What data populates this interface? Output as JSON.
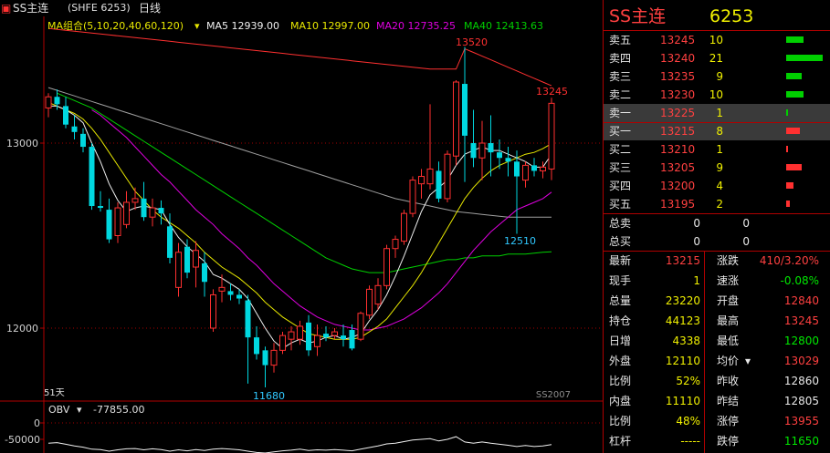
{
  "toolbar": {
    "symbol": "SS主连",
    "exchange": "(SHFE 6253)",
    "period": "日线"
  },
  "indicators": {
    "group_label": "MA组合(5,10,20,40,60,120)",
    "ma5": "MA5 12939.00",
    "ma10": "MA10 12997.00",
    "ma20": "MA20 12735.25",
    "ma40": "MA40 12413.63",
    "colors": {
      "ma5": "#f0f0f0",
      "ma10": "#e8e800",
      "ma20": "#e000e0",
      "ma40": "#00d000",
      "ma60": "#a0a0a0",
      "ma120": "#ff3030"
    }
  },
  "chart": {
    "price_ticks": [
      "13000",
      "12000"
    ],
    "annotations": {
      "high": "13520",
      "last_close": "13245",
      "local_low": "12510",
      "low": "11680"
    },
    "days_label": "51天",
    "watermark": "SS2007",
    "obv_label": "OBV",
    "obv_value": "-77855.00",
    "obv_ticks": [
      "0",
      "-50000"
    ],
    "candles": [
      {
        "o": 13190,
        "h": 13270,
        "l": 13140,
        "c": 13250
      },
      {
        "o": 13250,
        "h": 13290,
        "l": 13180,
        "c": 13210
      },
      {
        "o": 13200,
        "h": 13250,
        "l": 13080,
        "c": 13100
      },
      {
        "o": 13090,
        "h": 13150,
        "l": 13020,
        "c": 13060
      },
      {
        "o": 13050,
        "h": 13080,
        "l": 12950,
        "c": 12980
      },
      {
        "o": 12980,
        "h": 13000,
        "l": 12640,
        "c": 12660
      },
      {
        "o": 12660,
        "h": 12740,
        "l": 12630,
        "c": 12650
      },
      {
        "o": 12640,
        "h": 12700,
        "l": 12460,
        "c": 12480
      },
      {
        "o": 12500,
        "h": 12680,
        "l": 12460,
        "c": 12650
      },
      {
        "o": 12560,
        "h": 12740,
        "l": 12540,
        "c": 12680
      },
      {
        "o": 12680,
        "h": 12760,
        "l": 12640,
        "c": 12700
      },
      {
        "o": 12700,
        "h": 12790,
        "l": 12580,
        "c": 12600
      },
      {
        "o": 12600,
        "h": 12700,
        "l": 12550,
        "c": 12650
      },
      {
        "o": 12650,
        "h": 12690,
        "l": 12560,
        "c": 12620
      },
      {
        "o": 12550,
        "h": 12620,
        "l": 12350,
        "c": 12380
      },
      {
        "o": 12220,
        "h": 12460,
        "l": 12170,
        "c": 12410
      },
      {
        "o": 12440,
        "h": 12480,
        "l": 12270,
        "c": 12300
      },
      {
        "o": 12330,
        "h": 12470,
        "l": 12220,
        "c": 12420
      },
      {
        "o": 12350,
        "h": 12410,
        "l": 12170,
        "c": 12250
      },
      {
        "o": 12000,
        "h": 12210,
        "l": 11980,
        "c": 12180
      },
      {
        "o": 12200,
        "h": 12290,
        "l": 12140,
        "c": 12220
      },
      {
        "o": 12200,
        "h": 12240,
        "l": 12150,
        "c": 12180
      },
      {
        "o": 12180,
        "h": 12210,
        "l": 12130,
        "c": 12160
      },
      {
        "o": 12150,
        "h": 12180,
        "l": 11700,
        "c": 11950
      },
      {
        "o": 11950,
        "h": 12010,
        "l": 11830,
        "c": 11860
      },
      {
        "o": 11880,
        "h": 11900,
        "l": 11680,
        "c": 11800
      },
      {
        "o": 11800,
        "h": 11920,
        "l": 11760,
        "c": 11880
      },
      {
        "o": 11880,
        "h": 11980,
        "l": 11860,
        "c": 11960
      },
      {
        "o": 11940,
        "h": 12010,
        "l": 11880,
        "c": 11980
      },
      {
        "o": 11940,
        "h": 12040,
        "l": 11910,
        "c": 12010
      },
      {
        "o": 12030,
        "h": 12070,
        "l": 11850,
        "c": 11880
      },
      {
        "o": 11900,
        "h": 12020,
        "l": 11850,
        "c": 11960
      },
      {
        "o": 11970,
        "h": 12010,
        "l": 11930,
        "c": 11950
      },
      {
        "o": 11960,
        "h": 12000,
        "l": 11940,
        "c": 11980
      },
      {
        "o": 11960,
        "h": 12020,
        "l": 11900,
        "c": 11940
      },
      {
        "o": 11990,
        "h": 12020,
        "l": 11880,
        "c": 11890
      },
      {
        "o": 11940,
        "h": 12090,
        "l": 11930,
        "c": 12080
      },
      {
        "o": 12070,
        "h": 12230,
        "l": 12050,
        "c": 12210
      },
      {
        "o": 12130,
        "h": 12270,
        "l": 12100,
        "c": 12230
      },
      {
        "o": 12230,
        "h": 12450,
        "l": 12210,
        "c": 12430
      },
      {
        "o": 12430,
        "h": 12500,
        "l": 12380,
        "c": 12480
      },
      {
        "o": 12470,
        "h": 12640,
        "l": 12450,
        "c": 12620
      },
      {
        "o": 12620,
        "h": 12820,
        "l": 12600,
        "c": 12800
      },
      {
        "o": 12780,
        "h": 12860,
        "l": 12700,
        "c": 12820
      },
      {
        "o": 12780,
        "h": 13210,
        "l": 12750,
        "c": 12860
      },
      {
        "o": 12850,
        "h": 12900,
        "l": 12680,
        "c": 12700
      },
      {
        "o": 12700,
        "h": 12960,
        "l": 12680,
        "c": 12940
      },
      {
        "o": 12930,
        "h": 13340,
        "l": 12880,
        "c": 13330
      },
      {
        "o": 13320,
        "h": 13520,
        "l": 12790,
        "c": 13040
      },
      {
        "o": 13000,
        "h": 13180,
        "l": 12870,
        "c": 12920
      },
      {
        "o": 12920,
        "h": 13120,
        "l": 12800,
        "c": 13000
      },
      {
        "o": 13000,
        "h": 13150,
        "l": 12820,
        "c": 12950
      },
      {
        "o": 12950,
        "h": 13020,
        "l": 12860,
        "c": 12920
      },
      {
        "o": 12920,
        "h": 12980,
        "l": 12820,
        "c": 12900
      },
      {
        "o": 12900,
        "h": 12960,
        "l": 12510,
        "c": 12820
      },
      {
        "o": 12800,
        "h": 12900,
        "l": 12760,
        "c": 12880
      },
      {
        "o": 12880,
        "h": 12920,
        "l": 12820,
        "c": 12850
      },
      {
        "o": 12850,
        "h": 12900,
        "l": 12810,
        "c": 12870
      },
      {
        "o": 12860,
        "h": 13245,
        "l": 12800,
        "c": 13215
      }
    ],
    "ma5": [
      13200,
      13200,
      13180,
      13150,
      13110,
      13000,
      12900,
      12780,
      12690,
      12630,
      12650,
      12660,
      12650,
      12640,
      12560,
      12490,
      12440,
      12400,
      12360,
      12290,
      12270,
      12240,
      12210,
      12160,
      12080,
      12000,
      11930,
      11890,
      11920,
      11940,
      11920,
      11930,
      11950,
      11960,
      11940,
      11950,
      11970,
      12040,
      12100,
      12180,
      12280,
      12390,
      12510,
      12630,
      12720,
      12760,
      12800,
      12880,
      12940,
      12960,
      12980,
      12960,
      12960,
      12940,
      12920,
      12900,
      12870,
      12870,
      12939
    ],
    "ma10": [
      13220,
      13200,
      13180,
      13160,
      13130,
      13080,
      13020,
      12950,
      12880,
      12810,
      12740,
      12690,
      12640,
      12600,
      12570,
      12540,
      12500,
      12460,
      12410,
      12370,
      12330,
      12300,
      12270,
      12230,
      12190,
      12140,
      12100,
      12060,
      12030,
      12000,
      11970,
      11960,
      11950,
      11940,
      11940,
      11940,
      11950,
      11980,
      12010,
      12050,
      12110,
      12170,
      12230,
      12300,
      12380,
      12460,
      12540,
      12620,
      12700,
      12760,
      12810,
      12850,
      12880,
      12900,
      12920,
      12940,
      12950,
      12970,
      12997
    ],
    "ma20": [
      null,
      null,
      null,
      null,
      null,
      13180,
      13150,
      13110,
      13070,
      13030,
      12980,
      12930,
      12880,
      12830,
      12790,
      12740,
      12690,
      12640,
      12600,
      12560,
      12510,
      12470,
      12430,
      12380,
      12340,
      12290,
      12240,
      12200,
      12160,
      12120,
      12090,
      12060,
      12040,
      12020,
      12010,
      12000,
      11990,
      11990,
      12000,
      12010,
      12030,
      12050,
      12080,
      12110,
      12150,
      12190,
      12240,
      12300,
      12360,
      12420,
      12470,
      12520,
      12560,
      12600,
      12640,
      12660,
      12680,
      12700,
      12735
    ],
    "ma40": [
      null,
      13270,
      13250,
      13230,
      13210,
      13190,
      13160,
      13130,
      13100,
      13070,
      13040,
      13010,
      12980,
      12950,
      12920,
      12890,
      12860,
      12830,
      12800,
      12770,
      12740,
      12710,
      12680,
      12650,
      12620,
      12590,
      12560,
      12530,
      12500,
      12470,
      12440,
      12410,
      12380,
      12360,
      12340,
      12320,
      12310,
      12300,
      12300,
      12300,
      12310,
      12320,
      12330,
      12340,
      12350,
      12360,
      12370,
      12370,
      12380,
      12380,
      12390,
      12390,
      12390,
      12400,
      12400,
      12400,
      12405,
      12410,
      12413
    ],
    "ma60": [
      13300,
      13285,
      13270,
      13255,
      13240,
      13225,
      13210,
      13195,
      13180,
      13165,
      13150,
      13135,
      13120,
      13105,
      13090,
      13075,
      13060,
      13045,
      13030,
      13015,
      13000,
      12985,
      12970,
      12955,
      12940,
      12925,
      12910,
      12895,
      12880,
      12865,
      12850,
      12835,
      12820,
      12805,
      12790,
      12775,
      12760,
      12745,
      12730,
      12715,
      12700,
      12690,
      12680,
      12670,
      12660,
      12650,
      12640,
      12630,
      12625,
      12620,
      12615,
      12610,
      12605,
      12600,
      12600,
      12600,
      12600,
      12600,
      12600
    ],
    "ma120": [
      13620,
      13615,
      13610,
      13605,
      13600,
      13595,
      13590,
      13585,
      13580,
      13575,
      13570,
      13565,
      13560,
      13555,
      13550,
      13545,
      13540,
      13535,
      13530,
      13525,
      13520,
      13515,
      13510,
      13505,
      13500,
      13495,
      13490,
      13485,
      13480,
      13475,
      13470,
      13465,
      13460,
      13455,
      13450,
      13445,
      13440,
      13435,
      13430,
      13425,
      13420,
      13415,
      13410,
      13405,
      13400,
      13400,
      13400,
      13400,
      13510,
      13490,
      13470,
      13450,
      13430,
      13410,
      13390,
      13370,
      13350,
      13330,
      13310
    ],
    "obv": [
      -62000,
      -60000,
      -65000,
      -70000,
      -74000,
      -80000,
      -81000,
      -86000,
      -82000,
      -79000,
      -78000,
      -82000,
      -79000,
      -81000,
      -86000,
      -82000,
      -85000,
      -81000,
      -84000,
      -80000,
      -78000,
      -80000,
      -82000,
      -86000,
      -90000,
      -92000,
      -88000,
      -85000,
      -83000,
      -80000,
      -84000,
      -82000,
      -83000,
      -81000,
      -83000,
      -85000,
      -80000,
      -75000,
      -70000,
      -64000,
      -62000,
      -57000,
      -52000,
      -50000,
      -48000,
      -55000,
      -50000,
      -42000,
      -58000,
      -62000,
      -58000,
      -62000,
      -65000,
      -68000,
      -72000,
      -69000,
      -72000,
      -70000,
      -66000
    ]
  },
  "panel": {
    "title": "SS主连",
    "code": "6253",
    "asks": [
      {
        "label": "卖五",
        "price": "13245",
        "vol": "10",
        "bar": 0.48
      },
      {
        "label": "卖四",
        "price": "13240",
        "vol": "21",
        "bar": 1.0
      },
      {
        "label": "卖三",
        "price": "13235",
        "vol": "9",
        "bar": 0.43
      },
      {
        "label": "卖二",
        "price": "13230",
        "vol": "10",
        "bar": 0.48
      },
      {
        "label": "卖一",
        "price": "13225",
        "vol": "1",
        "bar": 0.05
      }
    ],
    "bids": [
      {
        "label": "买一",
        "price": "13215",
        "vol": "8",
        "bar": 0.38
      },
      {
        "label": "买二",
        "price": "13210",
        "vol": "1",
        "bar": 0.05
      },
      {
        "label": "买三",
        "price": "13205",
        "vol": "9",
        "bar": 0.43
      },
      {
        "label": "买四",
        "price": "13200",
        "vol": "4",
        "bar": 0.19
      },
      {
        "label": "买五",
        "price": "13195",
        "vol": "2",
        "bar": 0.1
      }
    ],
    "totals": [
      {
        "label": "总卖",
        "value": "0",
        "vol": "0"
      },
      {
        "label": "总买",
        "value": "0",
        "vol": "0"
      }
    ],
    "quotes": [
      {
        "l1": "最新",
        "v1": "13215",
        "c1": "red",
        "l2": "涨跌",
        "v2": "410/3.20%",
        "c2": "red"
      },
      {
        "l1": "现手",
        "v1": "1",
        "c1": "yel",
        "l2": "速涨",
        "v2": "-0.08%",
        "c2": "grn"
      },
      {
        "l1": "总量",
        "v1": "23220",
        "c1": "yel",
        "l2": "开盘",
        "v2": "12840",
        "c2": "red"
      },
      {
        "l1": "持仓",
        "v1": "44123",
        "c1": "yel",
        "l2": "最高",
        "v2": "13245",
        "c2": "red"
      },
      {
        "l1": "日增",
        "v1": "4338",
        "c1": "yel",
        "l2": "最低",
        "v2": "12800",
        "c2": "grn"
      },
      {
        "l1": "外盘",
        "v1": "12110",
        "c1": "yel",
        "l2": "均价",
        "v2": "13029",
        "c2": "red"
      },
      {
        "l1": "比例",
        "v1": "52%",
        "c1": "yel",
        "l2": "昨收",
        "v2": "12860",
        "c2": "wht"
      },
      {
        "l1": "内盘",
        "v1": "11110",
        "c1": "yel",
        "l2": "昨结",
        "v2": "12805",
        "c2": "wht"
      },
      {
        "l1": "比例",
        "v1": "48%",
        "c1": "yel",
        "l2": "涨停",
        "v2": "13955",
        "c2": "red"
      },
      {
        "l1": "杠杆",
        "v1": "-----",
        "c1": "yel",
        "l2": "跌停",
        "v2": "11650",
        "c2": "grn"
      }
    ]
  }
}
